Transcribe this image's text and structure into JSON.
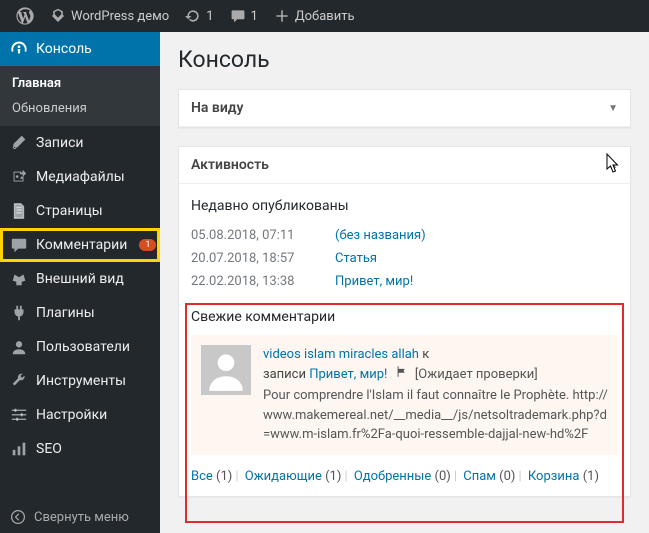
{
  "topbar": {
    "site_name": "WordPress демо",
    "updates_count": "1",
    "comments_count": "1",
    "add_new": "Добавить"
  },
  "sidebar": {
    "console": "Консоль",
    "home": "Главная",
    "updates": "Обновления",
    "posts": "Записи",
    "media": "Медиафайлы",
    "pages": "Страницы",
    "comments": "Комментарии",
    "comments_badge": "1",
    "appearance": "Внешний вид",
    "plugins": "Плагины",
    "users": "Пользователи",
    "tools": "Инструменты",
    "settings": "Настройки",
    "seo": "SEO",
    "collapse": "Свернуть меню"
  },
  "page": {
    "title": "Консоль",
    "glance_title": "На виду",
    "activity_title": "Активность",
    "recent_heading": "Недавно опубликованы",
    "posts": [
      {
        "date": "05.08.2018, 07:11",
        "title": "(без названия)"
      },
      {
        "date": "20.07.2018, 18:57",
        "title": "Статья"
      },
      {
        "date": "22.02.2018, 13:38",
        "title": "Привет, мир!"
      }
    ],
    "recent_comments_heading": "Свежие комментарии",
    "comment": {
      "author": "videos islam miracles allah",
      "to": " к",
      "on_prefix": "записи ",
      "post": "Привет, мир!",
      "pending": "[Ожидает проверки]",
      "excerpt": "Pour comprendre l'Islam il faut connaître le Prophète. http://www.makemereal.net/__media__/js/netsoltrademark.php?d=www.m-islam.fr%2Fa-quoi-ressemble-dajjal-new-hd%2F"
    },
    "filters": {
      "all": "Все",
      "all_cnt": "(1)",
      "pending": "Ожидающие",
      "pending_cnt": "(1)",
      "approved": "Одобренные",
      "approved_cnt": "(0)",
      "spam": "Спам",
      "spam_cnt": "(0)",
      "trash": "Корзина",
      "trash_cnt": "(1)"
    }
  }
}
